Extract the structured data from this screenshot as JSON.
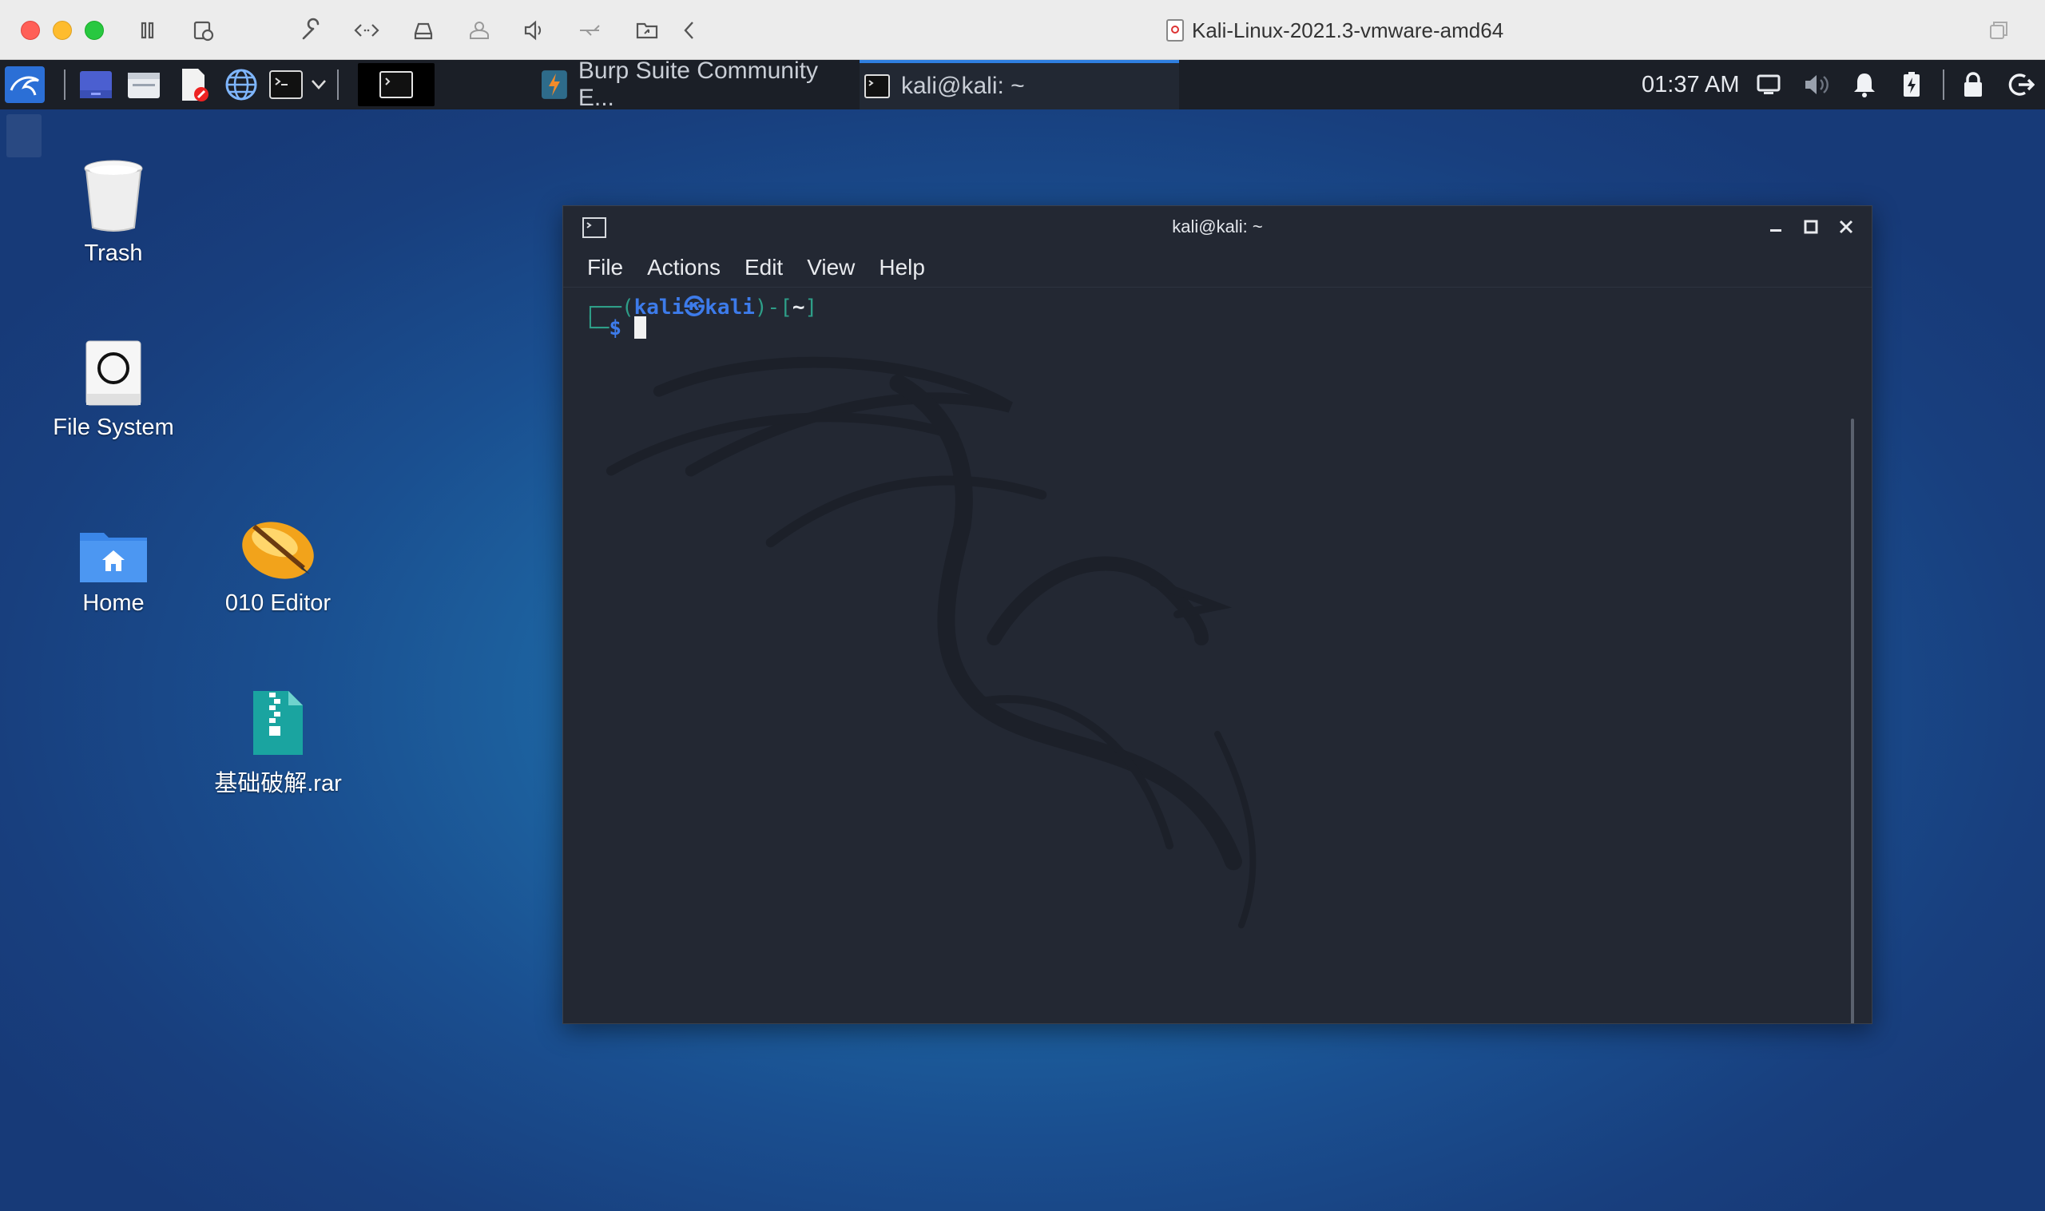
{
  "mac_window": {
    "title": "Kali-Linux-2021.3-vmware-amd64",
    "toolbar_icons": [
      "pause-icon",
      "snapshot-icon",
      "wrench-icon",
      "code-arrows-icon",
      "drive-icon",
      "user-icon",
      "speaker-icon",
      "usb-icon",
      "shared-folder-icon",
      "chevron-left-icon"
    ]
  },
  "panel": {
    "tasks": [
      {
        "label": "Burp Suite Community E...",
        "icon": "burp-icon",
        "active": false
      },
      {
        "label": "kali@kali: ~",
        "icon": "terminal-icon",
        "active": true
      }
    ],
    "clock": "01:37 AM"
  },
  "desktop": {
    "icons": [
      {
        "label": "Trash",
        "icon": "trash-icon"
      },
      {
        "label": "File System",
        "icon": "drive-icon"
      },
      {
        "label": "Home",
        "icon": "home-folder-icon"
      },
      {
        "label": "010 Editor",
        "icon": "editor-icon"
      },
      {
        "label": "基础破解.rar",
        "icon": "archive-icon"
      }
    ]
  },
  "terminal": {
    "title": "kali@kali: ~",
    "menu": [
      "File",
      "Actions",
      "Edit",
      "View",
      "Help"
    ],
    "prompt": {
      "corner_top": "┌──(",
      "user": "kali",
      "at_symbol": "㉿",
      "host": "kali",
      "mid": ")-[",
      "path": "~",
      "end": "]",
      "corner_bottom": "└─",
      "dollar": "$"
    },
    "colors": {
      "prompt_green": "#2e9e88",
      "prompt_blue": "#3d7bea",
      "background": "#232833"
    }
  }
}
